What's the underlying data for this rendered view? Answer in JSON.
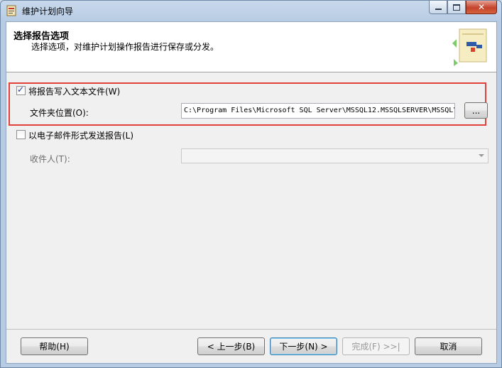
{
  "window": {
    "title": "维护计划向导"
  },
  "header": {
    "title": "选择报告选项",
    "subtitle": "选择选项，对维护计划操作报告进行保存或分发。"
  },
  "options": {
    "write_to_file": {
      "label": "将报告写入文本文件(W)",
      "checked": true
    },
    "folder_location": {
      "label": "文件夹位置(O):",
      "value": "C:\\Program Files\\Microsoft SQL Server\\MSSQL12.MSSQLSERVER\\MSSQL\\",
      "browse_label": "..."
    },
    "email_report": {
      "label": "以电子邮件形式发送报告(L)",
      "checked": false
    },
    "recipient": {
      "label": "收件人(T):",
      "value": ""
    }
  },
  "buttons": {
    "help": "帮助(H)",
    "back": "< 上一步(B)",
    "next": "下一步(N) >",
    "finish": "完成(F) >>|",
    "cancel": "取消"
  },
  "colors": {
    "highlight": "#e0413a",
    "close_button": "#c4422c"
  }
}
